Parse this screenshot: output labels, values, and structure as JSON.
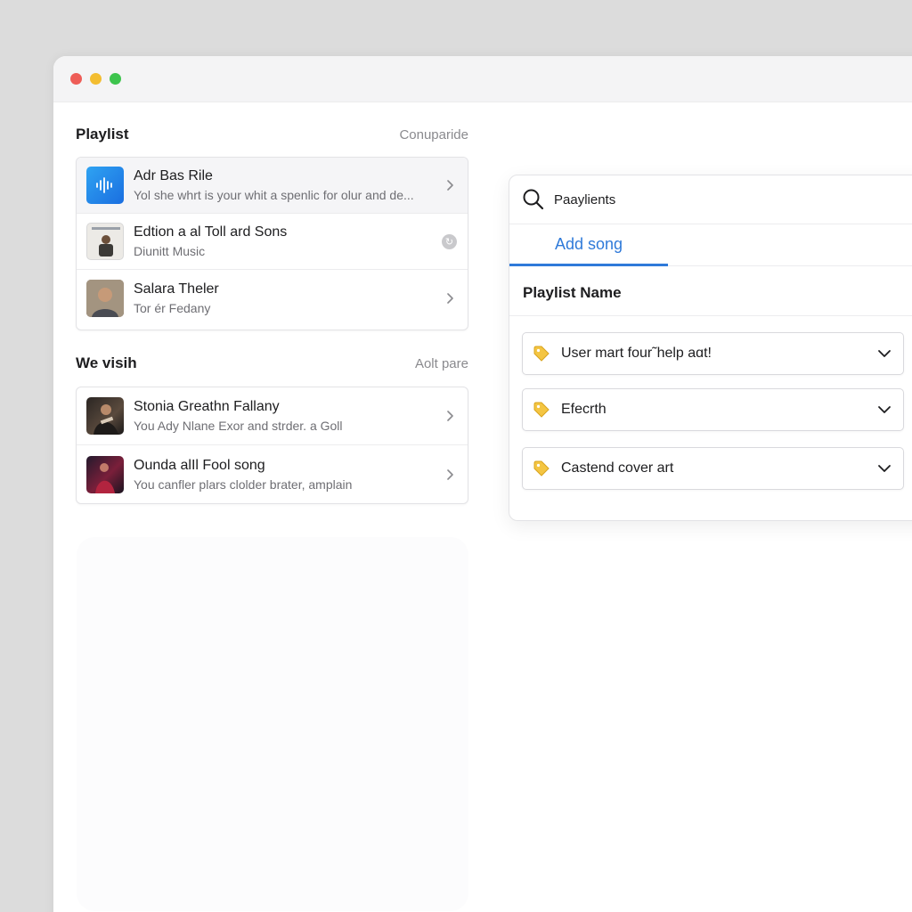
{
  "window": {
    "traffic_lights": [
      "close",
      "minimize",
      "zoom"
    ],
    "colors": {
      "close": "#ee5d57",
      "minimize": "#f3bd30",
      "zoom": "#3dc44d",
      "accent": "#2f7ad9"
    }
  },
  "playlist_section": {
    "title": "Playlist",
    "link": "Conuparide",
    "items": [
      {
        "title": "Adr Bas Rile",
        "subtitle": "Yol she whrt is your whit a spenlic for olur and de...",
        "thumb": "waveform-icon"
      },
      {
        "title": "Edtion a al Toll ard  Sons",
        "subtitle": "Diunitt Music",
        "thumb": "album-cover"
      },
      {
        "title": "Salara Theler",
        "subtitle": "Tor ér Fedany",
        "thumb": "artist-photo"
      }
    ]
  },
  "visih_section": {
    "title": "We visih",
    "link": "Aolt pare",
    "items": [
      {
        "title": "Stonia Greathn Fallany",
        "subtitle": "You Ady Nlane Exor and strder. а Goll",
        "thumb": "artist-photo"
      },
      {
        "title": "Ounda alIl Fool song",
        "subtitle": "You canfler plars clolder brater, amplain",
        "thumb": "artist-photo"
      }
    ]
  },
  "panel": {
    "search_label": "Paaylients",
    "tab_active": "Add song",
    "field_label": "Playlist Name",
    "dropdowns": [
      {
        "label": "User mart four˜help aɑt!",
        "icon": "tag-icon"
      },
      {
        "label": "Efecrth",
        "icon": "tag-icon"
      },
      {
        "label": "Castend cover art",
        "icon": "tag-icon"
      }
    ]
  }
}
